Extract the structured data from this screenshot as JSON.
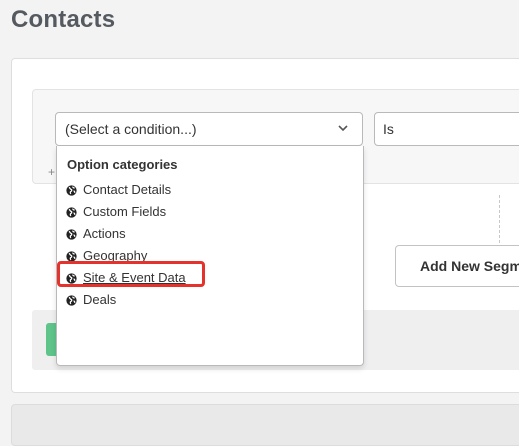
{
  "page": {
    "title": "Contacts"
  },
  "segment": {
    "condition_select": {
      "value": "(Select a condition...)"
    },
    "operator_select": {
      "value": "Is"
    },
    "add_mark": "+",
    "add_segment_button": "Add New Segme"
  },
  "dropdown": {
    "header": "Option categories",
    "items": [
      {
        "label": "Contact Details",
        "icon": "globe-icon"
      },
      {
        "label": "Custom Fields",
        "icon": "globe-icon"
      },
      {
        "label": "Actions",
        "icon": "globe-icon"
      },
      {
        "label": "Geography",
        "icon": "globe-icon"
      },
      {
        "label": "Site & Event Data",
        "icon": "globe-icon",
        "highlighted": true
      },
      {
        "label": "Deals",
        "icon": "globe-icon"
      }
    ]
  },
  "colors": {
    "highlight": "#e5322d",
    "green_button": "#5ec48a",
    "title": "#555a60"
  }
}
